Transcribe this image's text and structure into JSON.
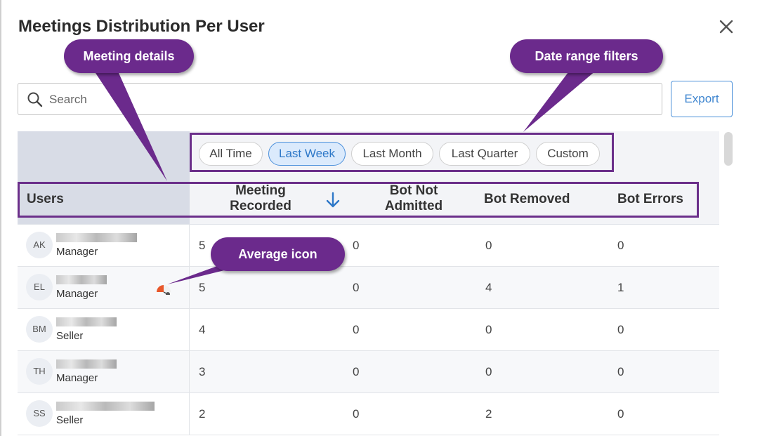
{
  "dialog": {
    "title": "Meetings Distribution Per User"
  },
  "search": {
    "placeholder": "Search",
    "value": ""
  },
  "export_label": "Export",
  "filters": {
    "options": [
      "All Time",
      "Last Week",
      "Last Month",
      "Last Quarter",
      "Custom"
    ],
    "selected": "Last Week"
  },
  "columns": {
    "users": "Users",
    "meeting_recorded_line1": "Meeting",
    "meeting_recorded_line2": "Recorded",
    "bot_not_admitted_line1": "Bot Not",
    "bot_not_admitted_line2": "Admitted",
    "bot_removed": "Bot Removed",
    "bot_errors": "Bot Errors"
  },
  "sort": {
    "column": "Meeting Recorded",
    "direction": "descending"
  },
  "rows": [
    {
      "initials": "AK",
      "role": "Manager",
      "meeting_recorded": "5",
      "bot_not_admitted": "0",
      "bot_removed": "0",
      "bot_errors": "0"
    },
    {
      "initials": "EL",
      "role": "Manager",
      "meeting_recorded": "5",
      "bot_not_admitted": "0",
      "bot_removed": "4",
      "bot_errors": "1"
    },
    {
      "initials": "BM",
      "role": "Seller",
      "meeting_recorded": "4",
      "bot_not_admitted": "0",
      "bot_removed": "0",
      "bot_errors": "0"
    },
    {
      "initials": "TH",
      "role": "Manager",
      "meeting_recorded": "3",
      "bot_not_admitted": "0",
      "bot_removed": "0",
      "bot_errors": "0"
    },
    {
      "initials": "SS",
      "role": "Seller",
      "meeting_recorded": "2",
      "bot_not_admitted": "0",
      "bot_removed": "2",
      "bot_errors": "0"
    }
  ],
  "annotations": {
    "meeting_details": "Meeting details",
    "date_range_filters": "Date range filters",
    "average_icon": "Average icon"
  },
  "colors": {
    "accent_blue": "#3f86d0",
    "callout_purple": "#6b2a8c",
    "average_icon_orange": "#e8572a"
  },
  "icons": {
    "search": "search-icon",
    "close": "close-icon",
    "sort": "arrow-down-icon",
    "average": "gauge-icon"
  }
}
